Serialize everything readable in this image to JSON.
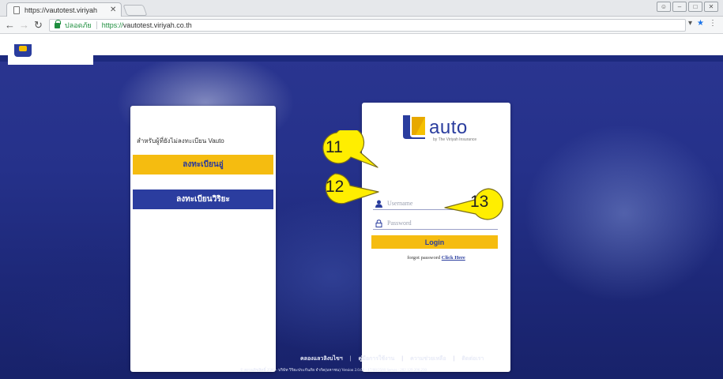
{
  "browser": {
    "tab_title": "https://vautotest.viriyah",
    "tab_close": "✕",
    "secure_label": "ปลอดภัย",
    "url_scheme": "https://",
    "url_host": "vautotest.viriyah.co.th"
  },
  "register_card": {
    "title": "สำหรับผู้ที่ยังไม่ลงทะเบียน Vauto",
    "yellow_button": "ลงทะเบียนอู่",
    "blue_button": "ลงทะเบียนวิริยะ"
  },
  "login_card": {
    "brand_name": "auto",
    "brand_tagline": "by The Viriyah Insurance",
    "username_placeholder": "Username",
    "password_placeholder": "Password",
    "login_button": "Login",
    "forgot_prefix": "forgot password",
    "forgot_link": "Click Here"
  },
  "callouts": [
    "11",
    "12",
    "13"
  ],
  "footer": {
    "links": [
      "คลองแลวลิงบไขฯ",
      "คู่มือการใช้งาน",
      "ความช่วยเหลือ",
      "ติดต่อเรา"
    ],
    "copyright": "© สงวนลิขสิทธิ์ 2560 - บริษัท วิริยะประกันภัย จำกัด(มหาชน) Version 2.0.09 - 17/08/2560 Server : 202.129.206.230"
  },
  "colors": {
    "brand_blue": "#2a3d9e",
    "brand_yellow": "#f5bc10",
    "callout_yellow": "#ffee00"
  }
}
